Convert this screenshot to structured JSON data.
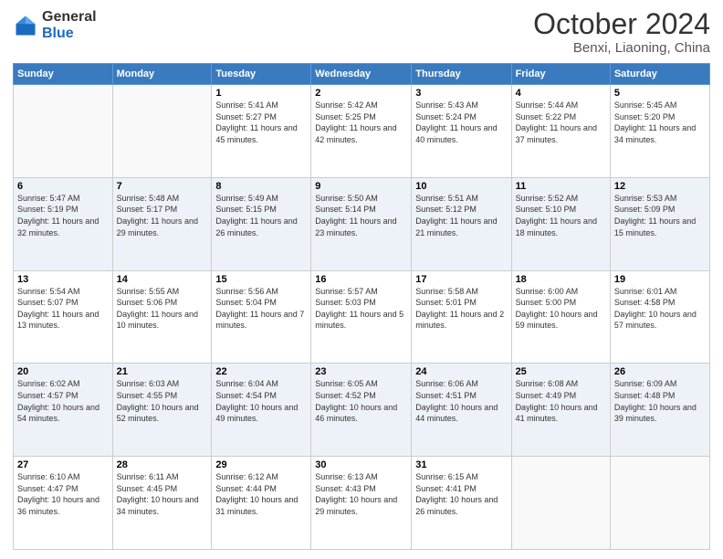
{
  "header": {
    "logo_general": "General",
    "logo_blue": "Blue",
    "month": "October 2024",
    "location": "Benxi, Liaoning, China"
  },
  "days_of_week": [
    "Sunday",
    "Monday",
    "Tuesday",
    "Wednesday",
    "Thursday",
    "Friday",
    "Saturday"
  ],
  "weeks": [
    [
      {
        "day": "",
        "sunrise": "",
        "sunset": "",
        "daylight": ""
      },
      {
        "day": "",
        "sunrise": "",
        "sunset": "",
        "daylight": ""
      },
      {
        "day": "1",
        "sunrise": "Sunrise: 5:41 AM",
        "sunset": "Sunset: 5:27 PM",
        "daylight": "Daylight: 11 hours and 45 minutes."
      },
      {
        "day": "2",
        "sunrise": "Sunrise: 5:42 AM",
        "sunset": "Sunset: 5:25 PM",
        "daylight": "Daylight: 11 hours and 42 minutes."
      },
      {
        "day": "3",
        "sunrise": "Sunrise: 5:43 AM",
        "sunset": "Sunset: 5:24 PM",
        "daylight": "Daylight: 11 hours and 40 minutes."
      },
      {
        "day": "4",
        "sunrise": "Sunrise: 5:44 AM",
        "sunset": "Sunset: 5:22 PM",
        "daylight": "Daylight: 11 hours and 37 minutes."
      },
      {
        "day": "5",
        "sunrise": "Sunrise: 5:45 AM",
        "sunset": "Sunset: 5:20 PM",
        "daylight": "Daylight: 11 hours and 34 minutes."
      }
    ],
    [
      {
        "day": "6",
        "sunrise": "Sunrise: 5:47 AM",
        "sunset": "Sunset: 5:19 PM",
        "daylight": "Daylight: 11 hours and 32 minutes."
      },
      {
        "day": "7",
        "sunrise": "Sunrise: 5:48 AM",
        "sunset": "Sunset: 5:17 PM",
        "daylight": "Daylight: 11 hours and 29 minutes."
      },
      {
        "day": "8",
        "sunrise": "Sunrise: 5:49 AM",
        "sunset": "Sunset: 5:15 PM",
        "daylight": "Daylight: 11 hours and 26 minutes."
      },
      {
        "day": "9",
        "sunrise": "Sunrise: 5:50 AM",
        "sunset": "Sunset: 5:14 PM",
        "daylight": "Daylight: 11 hours and 23 minutes."
      },
      {
        "day": "10",
        "sunrise": "Sunrise: 5:51 AM",
        "sunset": "Sunset: 5:12 PM",
        "daylight": "Daylight: 11 hours and 21 minutes."
      },
      {
        "day": "11",
        "sunrise": "Sunrise: 5:52 AM",
        "sunset": "Sunset: 5:10 PM",
        "daylight": "Daylight: 11 hours and 18 minutes."
      },
      {
        "day": "12",
        "sunrise": "Sunrise: 5:53 AM",
        "sunset": "Sunset: 5:09 PM",
        "daylight": "Daylight: 11 hours and 15 minutes."
      }
    ],
    [
      {
        "day": "13",
        "sunrise": "Sunrise: 5:54 AM",
        "sunset": "Sunset: 5:07 PM",
        "daylight": "Daylight: 11 hours and 13 minutes."
      },
      {
        "day": "14",
        "sunrise": "Sunrise: 5:55 AM",
        "sunset": "Sunset: 5:06 PM",
        "daylight": "Daylight: 11 hours and 10 minutes."
      },
      {
        "day": "15",
        "sunrise": "Sunrise: 5:56 AM",
        "sunset": "Sunset: 5:04 PM",
        "daylight": "Daylight: 11 hours and 7 minutes."
      },
      {
        "day": "16",
        "sunrise": "Sunrise: 5:57 AM",
        "sunset": "Sunset: 5:03 PM",
        "daylight": "Daylight: 11 hours and 5 minutes."
      },
      {
        "day": "17",
        "sunrise": "Sunrise: 5:58 AM",
        "sunset": "Sunset: 5:01 PM",
        "daylight": "Daylight: 11 hours and 2 minutes."
      },
      {
        "day": "18",
        "sunrise": "Sunrise: 6:00 AM",
        "sunset": "Sunset: 5:00 PM",
        "daylight": "Daylight: 10 hours and 59 minutes."
      },
      {
        "day": "19",
        "sunrise": "Sunrise: 6:01 AM",
        "sunset": "Sunset: 4:58 PM",
        "daylight": "Daylight: 10 hours and 57 minutes."
      }
    ],
    [
      {
        "day": "20",
        "sunrise": "Sunrise: 6:02 AM",
        "sunset": "Sunset: 4:57 PM",
        "daylight": "Daylight: 10 hours and 54 minutes."
      },
      {
        "day": "21",
        "sunrise": "Sunrise: 6:03 AM",
        "sunset": "Sunset: 4:55 PM",
        "daylight": "Daylight: 10 hours and 52 minutes."
      },
      {
        "day": "22",
        "sunrise": "Sunrise: 6:04 AM",
        "sunset": "Sunset: 4:54 PM",
        "daylight": "Daylight: 10 hours and 49 minutes."
      },
      {
        "day": "23",
        "sunrise": "Sunrise: 6:05 AM",
        "sunset": "Sunset: 4:52 PM",
        "daylight": "Daylight: 10 hours and 46 minutes."
      },
      {
        "day": "24",
        "sunrise": "Sunrise: 6:06 AM",
        "sunset": "Sunset: 4:51 PM",
        "daylight": "Daylight: 10 hours and 44 minutes."
      },
      {
        "day": "25",
        "sunrise": "Sunrise: 6:08 AM",
        "sunset": "Sunset: 4:49 PM",
        "daylight": "Daylight: 10 hours and 41 minutes."
      },
      {
        "day": "26",
        "sunrise": "Sunrise: 6:09 AM",
        "sunset": "Sunset: 4:48 PM",
        "daylight": "Daylight: 10 hours and 39 minutes."
      }
    ],
    [
      {
        "day": "27",
        "sunrise": "Sunrise: 6:10 AM",
        "sunset": "Sunset: 4:47 PM",
        "daylight": "Daylight: 10 hours and 36 minutes."
      },
      {
        "day": "28",
        "sunrise": "Sunrise: 6:11 AM",
        "sunset": "Sunset: 4:45 PM",
        "daylight": "Daylight: 10 hours and 34 minutes."
      },
      {
        "day": "29",
        "sunrise": "Sunrise: 6:12 AM",
        "sunset": "Sunset: 4:44 PM",
        "daylight": "Daylight: 10 hours and 31 minutes."
      },
      {
        "day": "30",
        "sunrise": "Sunrise: 6:13 AM",
        "sunset": "Sunset: 4:43 PM",
        "daylight": "Daylight: 10 hours and 29 minutes."
      },
      {
        "day": "31",
        "sunrise": "Sunrise: 6:15 AM",
        "sunset": "Sunset: 4:41 PM",
        "daylight": "Daylight: 10 hours and 26 minutes."
      },
      {
        "day": "",
        "sunrise": "",
        "sunset": "",
        "daylight": ""
      },
      {
        "day": "",
        "sunrise": "",
        "sunset": "",
        "daylight": ""
      }
    ]
  ]
}
